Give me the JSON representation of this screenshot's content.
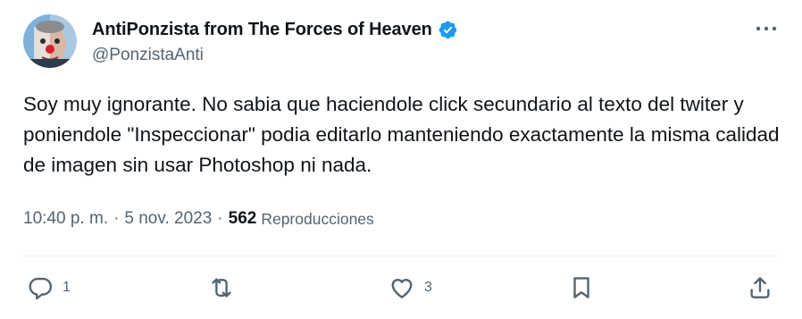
{
  "author": {
    "display_name": "AntiPonzista from The Forces of Heaven",
    "handle": "@PonzistaAnti",
    "verified_icon": "verified-badge-icon",
    "avatar_icon": "avatar"
  },
  "tweet": {
    "text": "Soy muy ignorante. No sabia que haciendole click secundario al texto del twiter y poniendole \"Inspeccionar\" podia editarlo manteniendo exactamente la misma calidad de imagen sin usar Photoshop ni nada."
  },
  "meta": {
    "time": "10:40 p. m.",
    "separator": "·",
    "date": "5 nov. 2023",
    "views_count": "562",
    "views_label": "Reproducciones"
  },
  "actions": {
    "reply_count": "1",
    "retweet_count": "",
    "like_count": "3",
    "bookmark_count": "",
    "share_count": ""
  },
  "colors": {
    "text_primary": "#0f1419",
    "text_secondary": "#536471",
    "verified_blue": "#1d9bf0",
    "divider": "#eff3f4"
  }
}
